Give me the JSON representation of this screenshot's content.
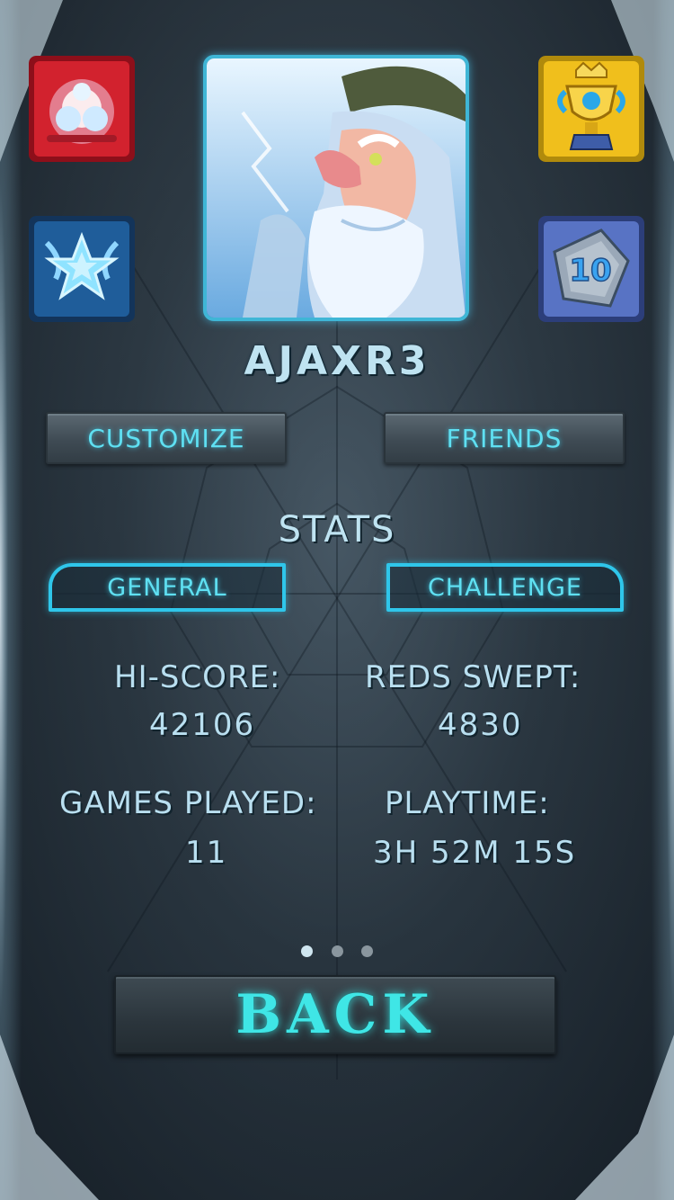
{
  "profile": {
    "username": "AJAXR3"
  },
  "badges": [
    {
      "name": "explosion-badge-icon",
      "color": "#c8202c"
    },
    {
      "name": "star-badge-icon",
      "color": "#2f8fd8"
    },
    {
      "name": "trophy-badge-icon",
      "color": "#f2c21a"
    },
    {
      "name": "level-10-badge-icon",
      "color": "#5a6fb8",
      "label": "10"
    }
  ],
  "actions": {
    "customize": "CUSTOMIZE",
    "friends": "FRIENDS"
  },
  "stats": {
    "title": "STATS",
    "tabs": [
      "GENERAL",
      "CHALLENGE"
    ],
    "hi_score_label": "HI-SCORE:",
    "hi_score": "42106",
    "reds_swept_label": "REDS SWEPT:",
    "reds_swept": "4830",
    "games_played_label": "GAMES PLAYED:",
    "games_played": "11",
    "playtime_label": "PLAYTIME:",
    "playtime": "3H 52M 15S"
  },
  "pager": {
    "pages": 3,
    "active": 1
  },
  "back_label": "BACK",
  "colors": {
    "accent": "#2fc6ea",
    "text": "#b9dff0",
    "back_text": "#3fe6e6"
  }
}
